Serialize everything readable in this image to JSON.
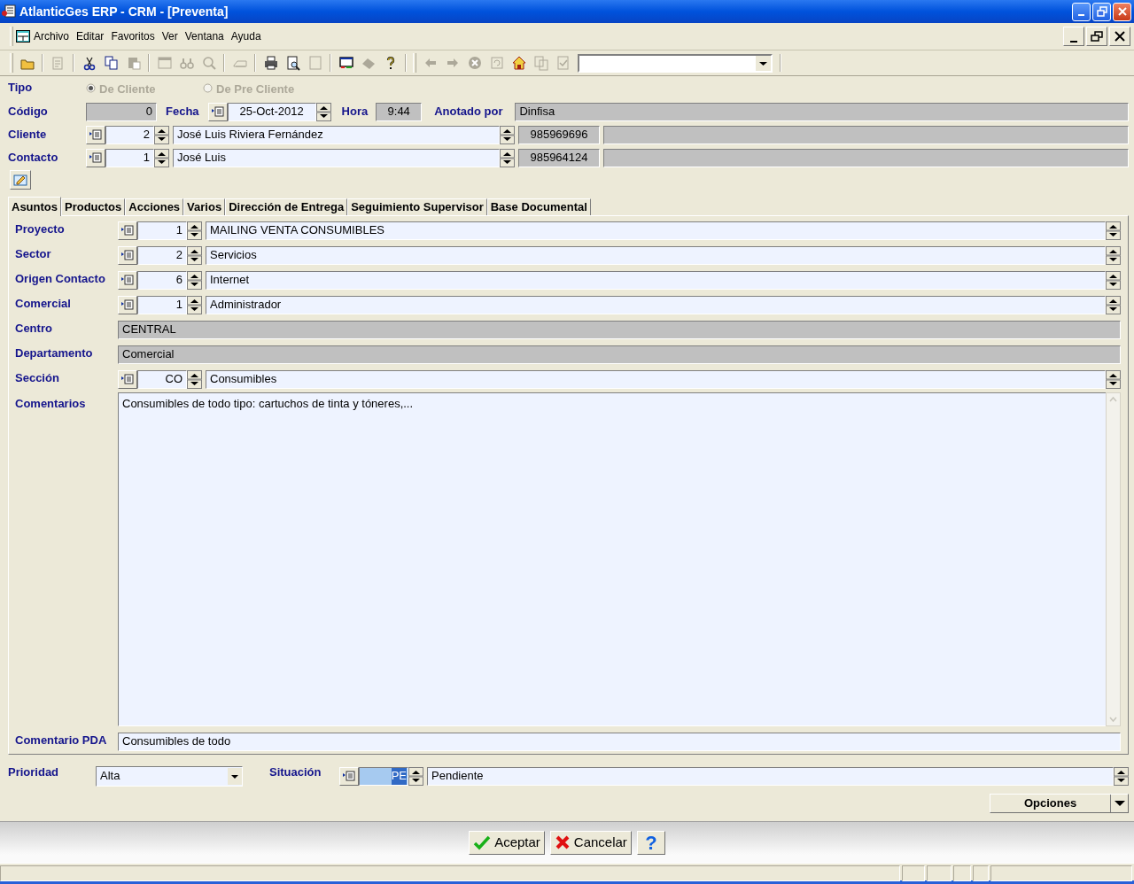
{
  "window": {
    "title": "AtlanticGes ERP - CRM - [Preventa]"
  },
  "menu": [
    "Archivo",
    "Editar",
    "Favoritos",
    "Ver",
    "Ventana",
    "Ayuda"
  ],
  "toolbar": {
    "groups": [
      {
        "items": [
          {
            "kind": "folder",
            "disabled": false
          }
        ]
      },
      {
        "items": [
          {
            "kind": "edit",
            "disabled": true
          }
        ]
      },
      {
        "items": [
          {
            "kind": "cut",
            "disabled": false
          },
          {
            "kind": "copy",
            "disabled": false
          },
          {
            "kind": "paste",
            "disabled": true
          }
        ]
      },
      {
        "items": [
          {
            "kind": "window",
            "disabled": true
          },
          {
            "kind": "binoculars",
            "disabled": true
          },
          {
            "kind": "search",
            "disabled": true
          }
        ]
      },
      {
        "items": [
          {
            "kind": "scanner",
            "disabled": true
          }
        ]
      },
      {
        "items": [
          {
            "kind": "printer",
            "disabled": false
          },
          {
            "kind": "preview",
            "disabled": false
          },
          {
            "kind": "page",
            "disabled": true
          }
        ]
      },
      {
        "items": [
          {
            "kind": "monitor",
            "disabled": false
          },
          {
            "kind": "eraser",
            "disabled": true
          },
          {
            "kind": "help",
            "disabled": false
          }
        ]
      },
      {
        "items": [
          {
            "kind": "back",
            "disabled": true
          },
          {
            "kind": "forward",
            "disabled": true
          },
          {
            "kind": "stop",
            "disabled": true
          },
          {
            "kind": "refresh",
            "disabled": true
          },
          {
            "kind": "home",
            "disabled": false
          },
          {
            "kind": "documents",
            "disabled": true
          },
          {
            "kind": "check",
            "disabled": true
          }
        ]
      }
    ]
  },
  "form": {
    "tipo": {
      "label": "Tipo",
      "options": [
        {
          "label": "De Cliente",
          "selected": true,
          "disabled": true
        },
        {
          "label": "De Pre Cliente",
          "selected": false,
          "disabled": true
        }
      ]
    },
    "codigo": {
      "label": "Código",
      "value": "0"
    },
    "fecha": {
      "label": "Fecha",
      "value": "25-Oct-2012"
    },
    "hora": {
      "label": "Hora",
      "value": "9:44"
    },
    "anotado_por": {
      "label": "Anotado por",
      "value": "Dinfisa"
    },
    "cliente": {
      "label": "Cliente",
      "code": "2",
      "name": "José Luis Riviera Fernández",
      "phone": "985969696"
    },
    "contacto": {
      "label": "Contacto",
      "code": "1",
      "name": "José Luis",
      "phone": "985964124"
    }
  },
  "tabs": [
    {
      "label": "Asuntos",
      "selected": true
    },
    {
      "label": "Productos",
      "selected": false
    },
    {
      "label": "Acciones",
      "selected": false
    },
    {
      "label": "Varios",
      "selected": false
    },
    {
      "label": "Dirección de Entrega",
      "selected": false
    },
    {
      "label": "Seguimiento Supervisor",
      "selected": false
    },
    {
      "label": "Base Documental",
      "selected": false
    }
  ],
  "fields": [
    {
      "kind": "lookup",
      "label": "Proyecto",
      "code": "1",
      "value": "MAILING VENTA CONSUMIBLES"
    },
    {
      "kind": "lookup",
      "label": "Sector",
      "code": "2",
      "value": "Servicios"
    },
    {
      "kind": "lookup",
      "label": "Origen Contacto",
      "code": "6",
      "value": "Internet"
    },
    {
      "kind": "lookup",
      "label": "Comercial",
      "code": "1",
      "value": "Administrador"
    },
    {
      "kind": "readonly",
      "label": "Centro",
      "value": "CENTRAL"
    },
    {
      "kind": "readonly",
      "label": "Departamento",
      "value": "Comercial"
    },
    {
      "kind": "lookup",
      "label": "Sección",
      "code": "CO",
      "value": "Consumibles"
    },
    {
      "kind": "memo",
      "label": "Comentarios",
      "value": "Consumibles de todo tipo: cartuchos de tinta y tóneres,..."
    },
    {
      "kind": "text",
      "label": "Comentario PDA",
      "value": "Consumibles de todo"
    }
  ],
  "prioridad": {
    "label": "Prioridad",
    "value": "Alta"
  },
  "situacion": {
    "label": "Situación",
    "code": "PE",
    "code_selected": true,
    "value": "Pendiente"
  },
  "options_button": "Opciones",
  "buttons": [
    {
      "kind": "accept",
      "label": "Aceptar"
    },
    {
      "kind": "cancel",
      "label": "Cancelar"
    },
    {
      "kind": "help",
      "label": "?"
    }
  ]
}
